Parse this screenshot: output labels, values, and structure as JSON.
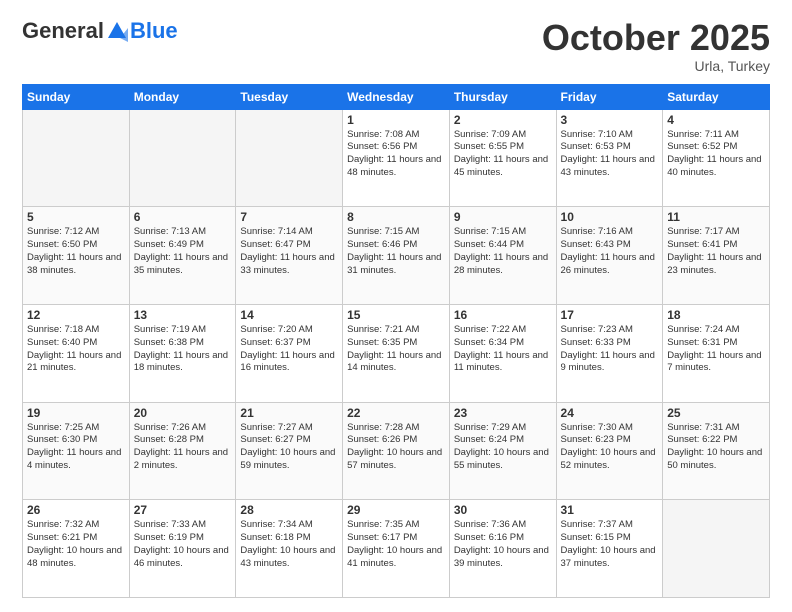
{
  "header": {
    "logo": {
      "general": "General",
      "blue": "Blue"
    },
    "title": "October 2025",
    "location": "Urla, Turkey"
  },
  "weekdays": [
    "Sunday",
    "Monday",
    "Tuesday",
    "Wednesday",
    "Thursday",
    "Friday",
    "Saturday"
  ],
  "weeks": [
    [
      {
        "day": "",
        "info": ""
      },
      {
        "day": "",
        "info": ""
      },
      {
        "day": "",
        "info": ""
      },
      {
        "day": "1",
        "info": "Sunrise: 7:08 AM\nSunset: 6:56 PM\nDaylight: 11 hours\nand 48 minutes."
      },
      {
        "day": "2",
        "info": "Sunrise: 7:09 AM\nSunset: 6:55 PM\nDaylight: 11 hours\nand 45 minutes."
      },
      {
        "day": "3",
        "info": "Sunrise: 7:10 AM\nSunset: 6:53 PM\nDaylight: 11 hours\nand 43 minutes."
      },
      {
        "day": "4",
        "info": "Sunrise: 7:11 AM\nSunset: 6:52 PM\nDaylight: 11 hours\nand 40 minutes."
      }
    ],
    [
      {
        "day": "5",
        "info": "Sunrise: 7:12 AM\nSunset: 6:50 PM\nDaylight: 11 hours\nand 38 minutes."
      },
      {
        "day": "6",
        "info": "Sunrise: 7:13 AM\nSunset: 6:49 PM\nDaylight: 11 hours\nand 35 minutes."
      },
      {
        "day": "7",
        "info": "Sunrise: 7:14 AM\nSunset: 6:47 PM\nDaylight: 11 hours\nand 33 minutes."
      },
      {
        "day": "8",
        "info": "Sunrise: 7:15 AM\nSunset: 6:46 PM\nDaylight: 11 hours\nand 31 minutes."
      },
      {
        "day": "9",
        "info": "Sunrise: 7:15 AM\nSunset: 6:44 PM\nDaylight: 11 hours\nand 28 minutes."
      },
      {
        "day": "10",
        "info": "Sunrise: 7:16 AM\nSunset: 6:43 PM\nDaylight: 11 hours\nand 26 minutes."
      },
      {
        "day": "11",
        "info": "Sunrise: 7:17 AM\nSunset: 6:41 PM\nDaylight: 11 hours\nand 23 minutes."
      }
    ],
    [
      {
        "day": "12",
        "info": "Sunrise: 7:18 AM\nSunset: 6:40 PM\nDaylight: 11 hours\nand 21 minutes."
      },
      {
        "day": "13",
        "info": "Sunrise: 7:19 AM\nSunset: 6:38 PM\nDaylight: 11 hours\nand 18 minutes."
      },
      {
        "day": "14",
        "info": "Sunrise: 7:20 AM\nSunset: 6:37 PM\nDaylight: 11 hours\nand 16 minutes."
      },
      {
        "day": "15",
        "info": "Sunrise: 7:21 AM\nSunset: 6:35 PM\nDaylight: 11 hours\nand 14 minutes."
      },
      {
        "day": "16",
        "info": "Sunrise: 7:22 AM\nSunset: 6:34 PM\nDaylight: 11 hours\nand 11 minutes."
      },
      {
        "day": "17",
        "info": "Sunrise: 7:23 AM\nSunset: 6:33 PM\nDaylight: 11 hours\nand 9 minutes."
      },
      {
        "day": "18",
        "info": "Sunrise: 7:24 AM\nSunset: 6:31 PM\nDaylight: 11 hours\nand 7 minutes."
      }
    ],
    [
      {
        "day": "19",
        "info": "Sunrise: 7:25 AM\nSunset: 6:30 PM\nDaylight: 11 hours\nand 4 minutes."
      },
      {
        "day": "20",
        "info": "Sunrise: 7:26 AM\nSunset: 6:28 PM\nDaylight: 11 hours\nand 2 minutes."
      },
      {
        "day": "21",
        "info": "Sunrise: 7:27 AM\nSunset: 6:27 PM\nDaylight: 10 hours\nand 59 minutes."
      },
      {
        "day": "22",
        "info": "Sunrise: 7:28 AM\nSunset: 6:26 PM\nDaylight: 10 hours\nand 57 minutes."
      },
      {
        "day": "23",
        "info": "Sunrise: 7:29 AM\nSunset: 6:24 PM\nDaylight: 10 hours\nand 55 minutes."
      },
      {
        "day": "24",
        "info": "Sunrise: 7:30 AM\nSunset: 6:23 PM\nDaylight: 10 hours\nand 52 minutes."
      },
      {
        "day": "25",
        "info": "Sunrise: 7:31 AM\nSunset: 6:22 PM\nDaylight: 10 hours\nand 50 minutes."
      }
    ],
    [
      {
        "day": "26",
        "info": "Sunrise: 7:32 AM\nSunset: 6:21 PM\nDaylight: 10 hours\nand 48 minutes."
      },
      {
        "day": "27",
        "info": "Sunrise: 7:33 AM\nSunset: 6:19 PM\nDaylight: 10 hours\nand 46 minutes."
      },
      {
        "day": "28",
        "info": "Sunrise: 7:34 AM\nSunset: 6:18 PM\nDaylight: 10 hours\nand 43 minutes."
      },
      {
        "day": "29",
        "info": "Sunrise: 7:35 AM\nSunset: 6:17 PM\nDaylight: 10 hours\nand 41 minutes."
      },
      {
        "day": "30",
        "info": "Sunrise: 7:36 AM\nSunset: 6:16 PM\nDaylight: 10 hours\nand 39 minutes."
      },
      {
        "day": "31",
        "info": "Sunrise: 7:37 AM\nSunset: 6:15 PM\nDaylight: 10 hours\nand 37 minutes."
      },
      {
        "day": "",
        "info": ""
      }
    ]
  ]
}
